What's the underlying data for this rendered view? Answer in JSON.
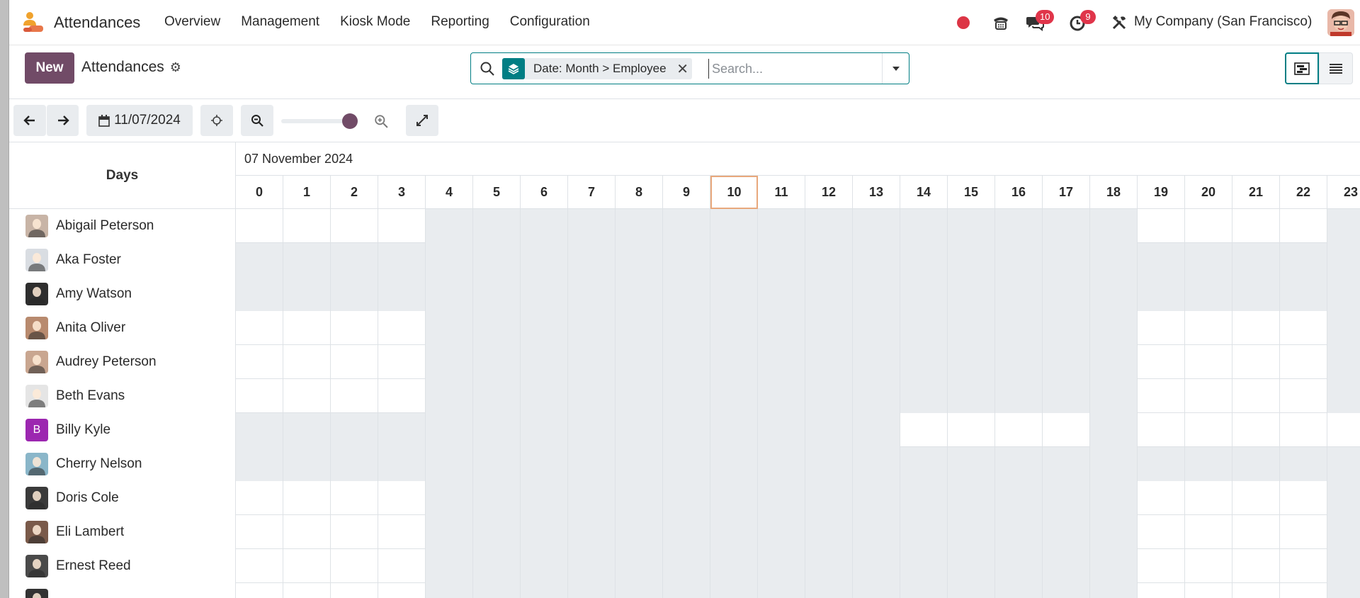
{
  "app": {
    "name": "Attendances",
    "menu": [
      "Overview",
      "Management",
      "Kiosk Mode",
      "Reporting",
      "Configuration"
    ],
    "messages_badge": "10",
    "activities_badge": "9",
    "company": "My Company (San Francisco)"
  },
  "control": {
    "new_label": "New",
    "breadcrumb": "Attendances",
    "facet": "Date: Month > Employee",
    "search_placeholder": "Search..."
  },
  "toolbar": {
    "date": "11/07/2024"
  },
  "gantt": {
    "days_header": "Days",
    "period_label": "07 November 2024",
    "hours": [
      "0",
      "1",
      "2",
      "3",
      "4",
      "5",
      "6",
      "7",
      "8",
      "9",
      "10",
      "11",
      "12",
      "13",
      "14",
      "15",
      "16",
      "17",
      "18",
      "19",
      "20",
      "21",
      "22",
      "23"
    ],
    "today_hour": "10",
    "rows": [
      {
        "name": "Abigail Peterson",
        "avatar": "photo",
        "avatar_color": "#c8b4a6"
      },
      {
        "name": "Aka Foster",
        "avatar": "photo",
        "avatar_color": "#d9dde2"
      },
      {
        "name": "Amy Watson",
        "avatar": "photo",
        "avatar_color": "#2e2e2e"
      },
      {
        "name": "Anita Oliver",
        "avatar": "photo",
        "avatar_color": "#b88a6e"
      },
      {
        "name": "Audrey Peterson",
        "avatar": "photo",
        "avatar_color": "#c9a690"
      },
      {
        "name": "Beth Evans",
        "avatar": "photo",
        "avatar_color": "#e5e5e5"
      },
      {
        "name": "Billy Kyle",
        "avatar": "B",
        "avatar_color": "#9c27b0"
      },
      {
        "name": "Cherry Nelson",
        "avatar": "photo",
        "avatar_color": "#8ab6c9"
      },
      {
        "name": "Doris Cole",
        "avatar": "photo",
        "avatar_color": "#3a3a3a"
      },
      {
        "name": "Eli Lambert",
        "avatar": "photo",
        "avatar_color": "#7a5a4a"
      },
      {
        "name": "Ernest Reed",
        "avatar": "photo",
        "avatar_color": "#4a4a4a"
      },
      {
        "name": "",
        "avatar": "photo",
        "avatar_color": "#333333"
      }
    ]
  }
}
